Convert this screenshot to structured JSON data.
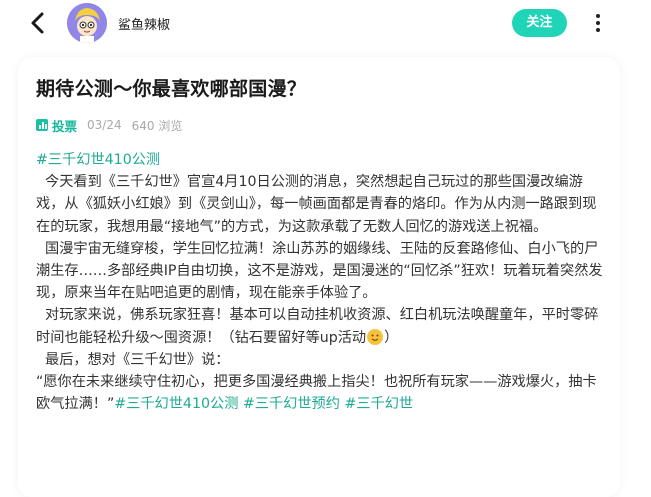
{
  "header": {
    "author_name": "鲨鱼辣椒",
    "follow_label": "关注"
  },
  "post": {
    "title": "期待公测～你最喜欢哪部国漫？",
    "type_label": "投票",
    "date": "03/24",
    "views": "640 浏览",
    "tag_line": "#三千幻世410公测",
    "paragraphs": [
      "今天看到《三千幻世》官宣4月10日公测的消息，突然想起自己玩过的那些国漫改编游戏，从《狐妖小红娘》到《灵剑山》，每一帧画面都是青春的烙印。作为从内测一路跟到现在的玩家，我想用最“接地气”的方式，为这款承载了无数人回忆的游戏送上祝福。",
      "国漫宇宙无缝穿梭，学生回忆拉满！涂山苏苏的姻缘线、王陆的反套路修仙、白小飞的尸潮生存……多部经典IP自由切换，这不是游戏，是国漫迷的“回忆杀”狂欢！玩着玩着突然发现，原来当年在贴吧追更的剧情，现在能亲手体验了。",
      "对玩家来说，佛系玩家狂喜！基本可以自动挂机收资源、红白机玩法唤醒童年，平时零碎时间也能轻松升级～囤资源！（钻石要留好等up活动",
      "最后，想对《三千幻世》说：",
      "“愿你在未来继续守住初心，把更多国漫经典搬上指尖！也祝所有玩家——游戏爆火，抽卡欧气拉满！”"
    ],
    "paragraph3_tail": "）",
    "tags_end": [
      "#三千幻世410公测",
      "#三千幻世预约",
      "#三千幻世"
    ]
  },
  "colors": {
    "accent": "#20d5b7",
    "tag": "#1eaa93"
  }
}
